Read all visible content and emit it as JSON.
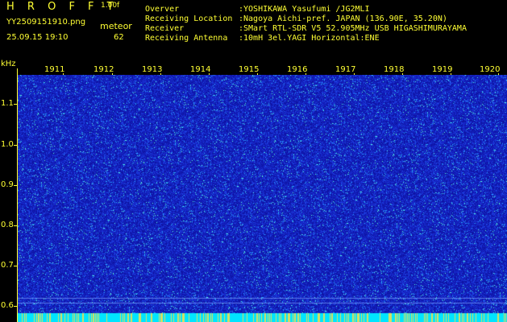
{
  "header": {
    "brand": "H R O F F T",
    "version": "1.00f",
    "filename": "YY2509151910.png",
    "mode": "meteor",
    "datetime": "25.09.15 19:10",
    "count": "62"
  },
  "info": [
    {
      "key": "Overver",
      "value": ":YOSHIKAWA Yasufumi /JG2MLI"
    },
    {
      "key": "Receiving Location",
      "value": ":Nagoya Aichi-pref. JAPAN (136.90E, 35.20N)"
    },
    {
      "key": "Receiver",
      "value": ":SMart RTL-SDR V5 52.905MHz USB HIGASHIMURAYAMA"
    },
    {
      "key": "Receiving Antenna",
      "value": ":10mH 3el.YAGI Horizontal:ENE"
    }
  ],
  "axis": {
    "y_unit": "kHz",
    "y_ticks": [
      "1.1",
      "1.0",
      "0.9",
      "0.8",
      "0.7",
      "0.6"
    ],
    "x_ticks": [
      "1911",
      "1912",
      "1913",
      "1914",
      "1915",
      "1916",
      "1917",
      "1918",
      "1919",
      "1920"
    ]
  },
  "colors": {
    "text": "#ffff33",
    "background": "#000000",
    "spectrum_base": "#1a22c8",
    "spectrum_noise": "#33ffff",
    "baseline": "#00e5ff"
  }
}
